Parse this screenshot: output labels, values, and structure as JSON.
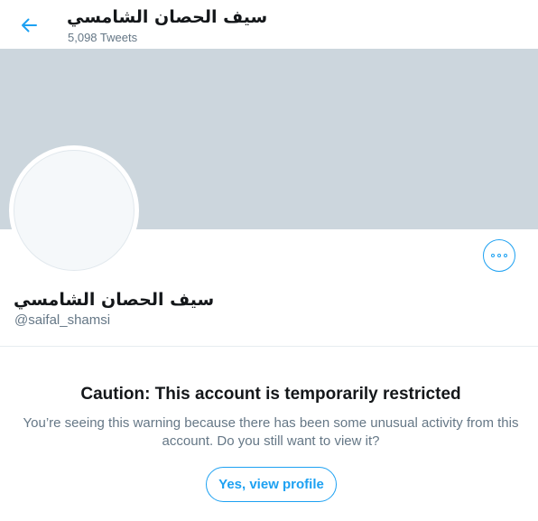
{
  "header": {
    "back_icon": "arrow-left-icon",
    "title": "سيف الحصان الشامسي",
    "tweet_count": "5,098 Tweets"
  },
  "profile": {
    "name": "سيف الحصان الشامسي",
    "handle": "@saifal_shamsi",
    "more_icon": "more-options-icon"
  },
  "warning": {
    "title": "Caution: This account is temporarily restricted",
    "message": "You’re seeing this warning because there has been some unusual activity from this account. Do you still want to view it?",
    "button_label": "Yes, view profile"
  },
  "colors": {
    "accent": "#1da1f2",
    "banner": "#ccd6dd",
    "secondary_text": "#657786",
    "primary_text": "#14171a",
    "divider": "#e6ecf0"
  }
}
